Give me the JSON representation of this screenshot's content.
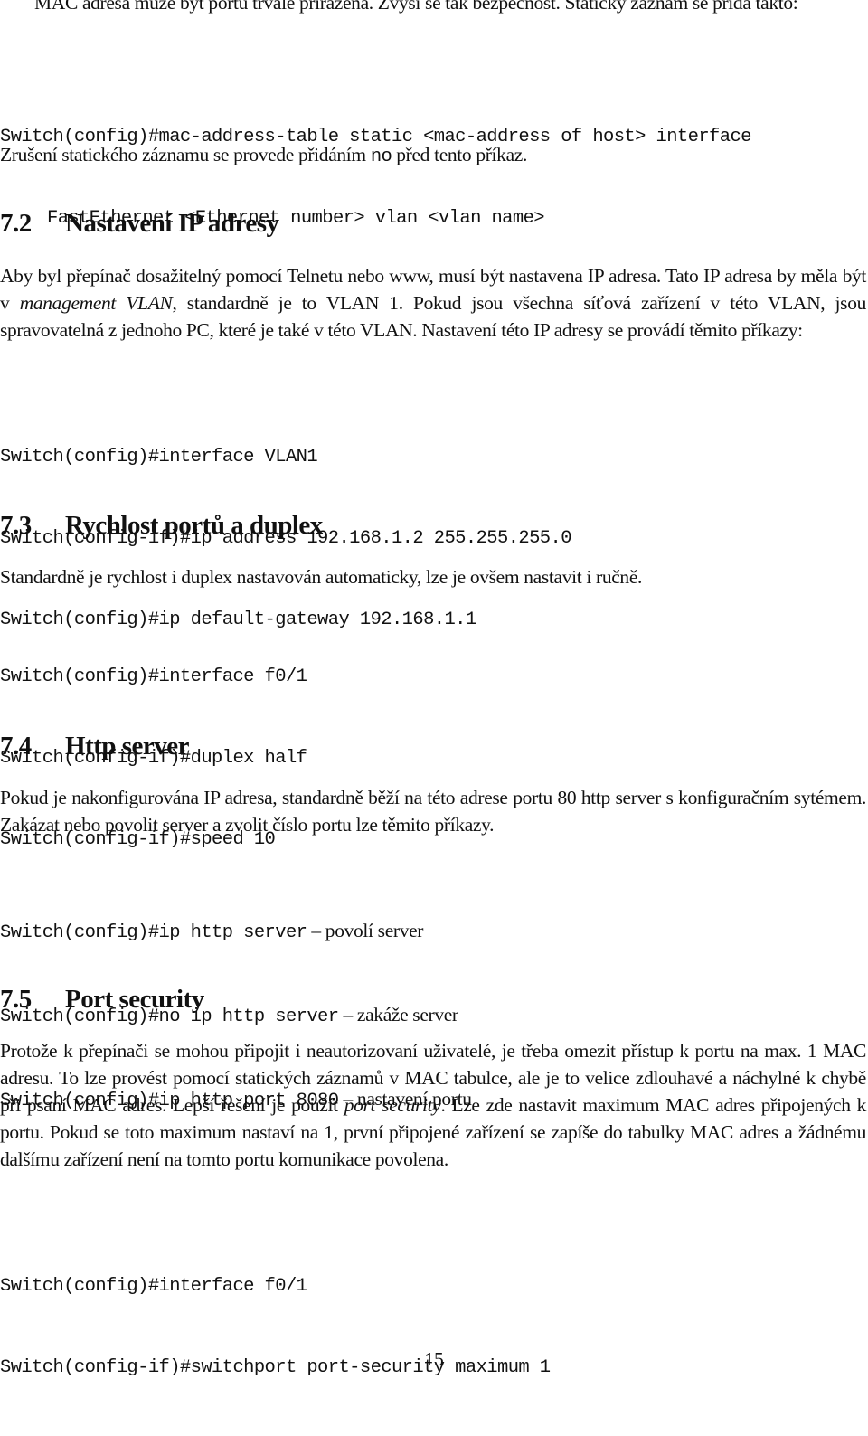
{
  "intro": {
    "paragraph": "MAC adresa může být portu trvale přiřazena. Zvýší se tak bezpečnost. Statický záznam se přidá takto:",
    "code": [
      "Switch(config)#mac-address-table static <mac-address of host> interface",
      "FastEthernet <Ethernet number> vlan <vlan name>"
    ],
    "removal_before": "Zrušení statického záznamu se provede přidáním ",
    "removal_code": "no",
    "removal_after": " před tento příkaz."
  },
  "sections": [
    {
      "number": "7.2",
      "title": "Nastavení IP adresy",
      "p_part1": "Aby byl přepínač dosažitelný pomocí Telnetu nebo www, musí být nastavena IP adresa. Tato IP adresa by měla být v ",
      "p_em": "management VLAN",
      "p_part2": ", standardně je to VLAN 1. Pokud jsou všechna síťová zařízení v této VLAN, jsou spravovatelná z jednoho PC, které je také v této VLAN. Nastavení této IP adresy se provádí těmito příkazy:",
      "code": [
        "Switch(config)#interface VLAN1",
        "Switch(config-if)#ip address 192.168.1.2 255.255.255.0",
        "Switch(config)#ip default-gateway 192.168.1.1"
      ]
    },
    {
      "number": "7.3",
      "title": "Rychlost portů a duplex",
      "paragraph": "Standardně je rychlost i duplex nastavován automaticky, lze je ovšem nastavit i ručně.",
      "code": [
        "Switch(config)#interface f0/1",
        "Switch(config-if)#duplex half",
        "Switch(config-if)#speed 10"
      ]
    },
    {
      "number": "7.4",
      "title": "Http server",
      "paragraph": "Pokud je nakonfigurována IP adresa, standardně běží na této adrese portu 80 http server s konfiguračním sytémem. Zakázat nebo povolit server a zvolit číslo portu lze těmito příkazy.",
      "code": [
        {
          "cmd": "Switch(config)#ip http server",
          "comment": " – povolí server"
        },
        {
          "cmd": "Switch(config)#no ip http server",
          "comment": " – zakáže server"
        },
        {
          "cmd": "Switch(config)#ip http port 8080",
          "comment": " – nastavení portu"
        }
      ]
    },
    {
      "number": "7.5",
      "title": "Port security",
      "p_part1": "Protože k přepínači se mohou připojit i neautorizovaní uživatelé, je třeba omezit přístup k portu na max. 1 MAC adresu. To lze provést pomocí statických záznamů v MAC tabulce, ale je to velice zdlouhavé a náchylné k chybě při psaní MAC adres. Lepší řešení je použít ",
      "p_em": "port security",
      "p_part2": ". Lze zde nastavit maximum MAC adres připojených k portu. Pokud se toto maximum nastaví na 1, první připojené zařízení se zapíše do tabulky MAC adres a žádnému dalšímu zařízení není na tomto portu komunikace povolena.",
      "code": [
        "Switch(config)#interface f0/1",
        "Switch(config-if)#switchport port-security maximum 1"
      ]
    }
  ],
  "footer": {
    "page_number": "15"
  }
}
